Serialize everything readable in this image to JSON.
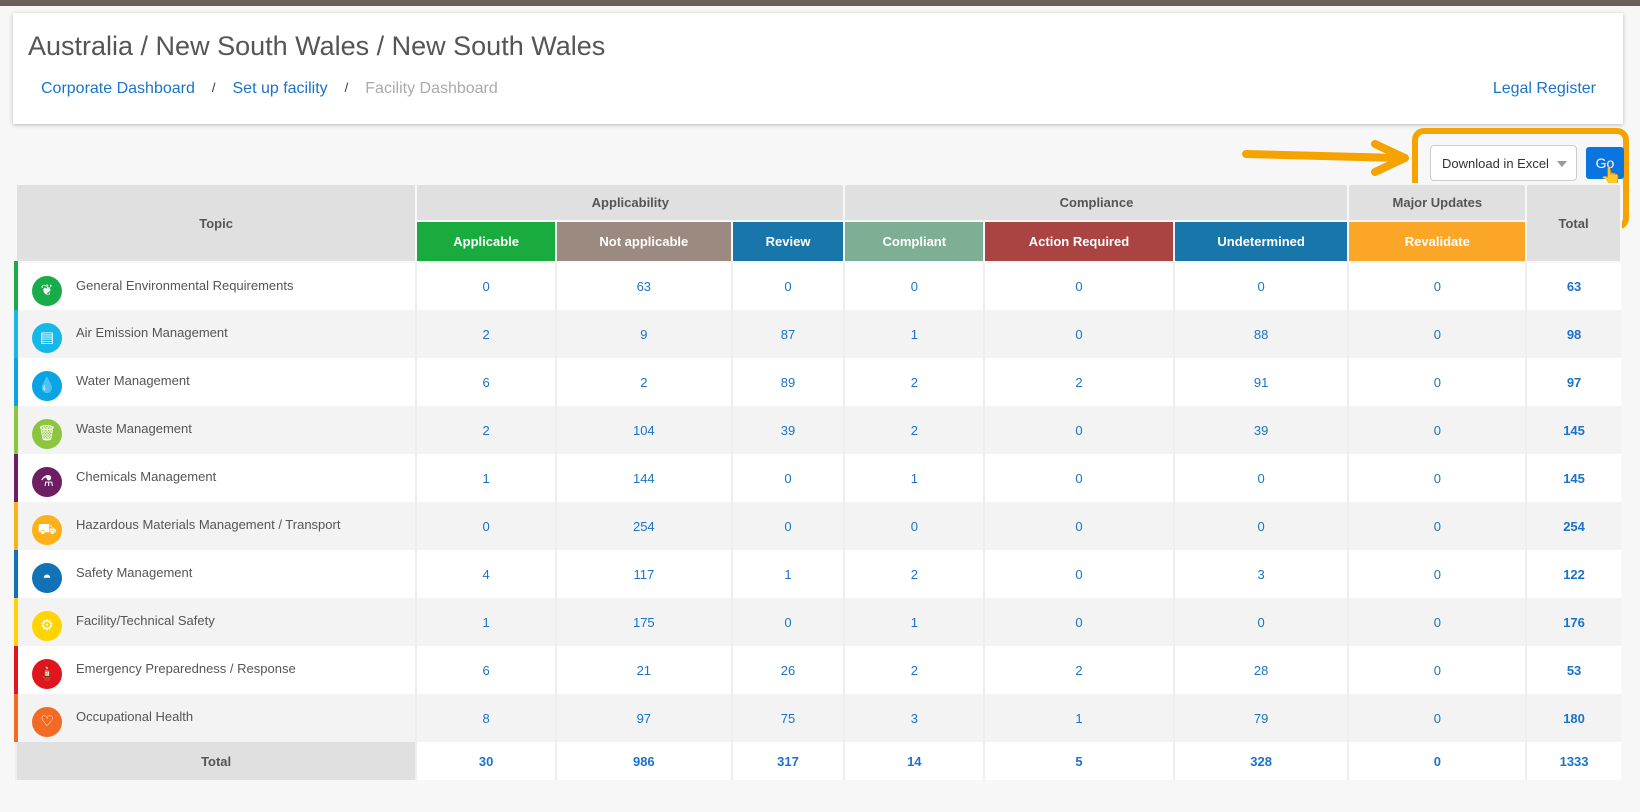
{
  "header": {
    "title": "Australia / New South Wales / New South Wales",
    "breadcrumbs": [
      "Corporate Dashboard",
      "Set up facility",
      "Facility Dashboard"
    ],
    "breadcrumb_sep": "/",
    "legal_register": "Legal Register"
  },
  "controls": {
    "export_select": "Download in Excel",
    "go_label": "Go",
    "highlight_color": "#f4a300"
  },
  "table": {
    "topic_header": "Topic",
    "groups": [
      "Applicability",
      "Compliance",
      "Major Updates"
    ],
    "total_header": "Total",
    "columns": [
      {
        "label": "Applicable",
        "color": "#1aab3e"
      },
      {
        "label": "Not applicable",
        "color": "#9b8a80"
      },
      {
        "label": "Review",
        "color": "#1876ab"
      },
      {
        "label": "Compliant",
        "color": "#7eae94"
      },
      {
        "label": "Action Required",
        "color": "#a94442"
      },
      {
        "label": "Undetermined",
        "color": "#1876ab"
      },
      {
        "label": "Revalidate",
        "color": "#fba627"
      }
    ],
    "rows": [
      {
        "topic": "General Environmental Requirements",
        "icon": "leaf-icon",
        "color": "#1aac4a",
        "values": [
          "0",
          "63",
          "0",
          "0",
          "0",
          "0",
          "0"
        ],
        "total": "63"
      },
      {
        "topic": "Air Emission Management",
        "icon": "factory-icon",
        "color": "#14b9e8",
        "values": [
          "2",
          "9",
          "87",
          "1",
          "0",
          "88",
          "0"
        ],
        "total": "98"
      },
      {
        "topic": "Water Management",
        "icon": "water-drop-icon",
        "color": "#0aa3e4",
        "values": [
          "6",
          "2",
          "89",
          "2",
          "2",
          "91",
          "0"
        ],
        "total": "97"
      },
      {
        "topic": "Waste Management",
        "icon": "trash-icon",
        "color": "#8cc63f",
        "values": [
          "2",
          "104",
          "39",
          "2",
          "0",
          "39",
          "0"
        ],
        "total": "145"
      },
      {
        "topic": "Chemicals Management",
        "icon": "flask-icon",
        "color": "#6e1e63",
        "values": [
          "1",
          "144",
          "0",
          "1",
          "0",
          "0",
          "0"
        ],
        "total": "145"
      },
      {
        "topic": "Hazardous Materials Management / Transport",
        "icon": "truck-icon",
        "color": "#fbb117",
        "values": [
          "0",
          "254",
          "0",
          "0",
          "0",
          "0",
          "0"
        ],
        "total": "254"
      },
      {
        "topic": "Safety Management",
        "icon": "hard-hat-icon",
        "color": "#1272b6",
        "values": [
          "4",
          "117",
          "1",
          "2",
          "0",
          "3",
          "0"
        ],
        "total": "122"
      },
      {
        "topic": "Facility/Technical Safety",
        "icon": "gear-icon",
        "color": "#ffd400",
        "values": [
          "1",
          "175",
          "0",
          "1",
          "0",
          "0",
          "0"
        ],
        "total": "176"
      },
      {
        "topic": "Emergency Preparedness / Response",
        "icon": "fire-extinguisher-icon",
        "color": "#e0161f",
        "values": [
          "6",
          "21",
          "26",
          "2",
          "2",
          "28",
          "0"
        ],
        "total": "53"
      },
      {
        "topic": "Occupational Health",
        "icon": "heartbeat-icon",
        "color": "#f26a24",
        "values": [
          "8",
          "97",
          "75",
          "3",
          "1",
          "79",
          "0"
        ],
        "total": "180"
      }
    ],
    "total_row": {
      "label": "Total",
      "values": [
        "30",
        "986",
        "317",
        "14",
        "5",
        "328",
        "0"
      ],
      "total": "1333"
    }
  }
}
